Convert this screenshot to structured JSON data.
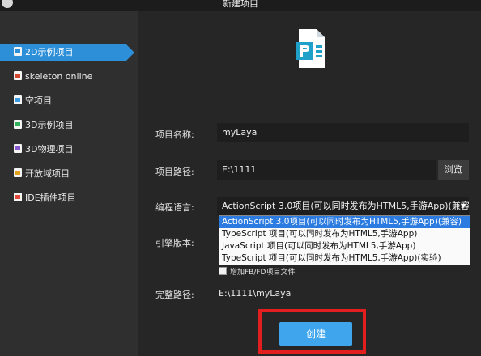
{
  "window": {
    "title": "新建项目"
  },
  "sidebar": {
    "items": [
      {
        "label": "2D示例项目",
        "active": true
      },
      {
        "label": "skeleton online"
      },
      {
        "label": "空项目"
      },
      {
        "label": "3D示例项目"
      },
      {
        "label": "3D物理项目"
      },
      {
        "label": "开放域项目"
      },
      {
        "label": "IDE插件项目"
      }
    ]
  },
  "form": {
    "name_label": "项目名称:",
    "name_value": "myLaya",
    "path_label": "项目路径:",
    "path_value": "E:\\1111",
    "browse_label": "浏览",
    "lang_label": "编程语言:",
    "lang_value": "ActionScript 3.0项目(可以同时发布为HTML5,手游App)(兼容)",
    "lang_options": [
      "ActionScript 3.0项目(可以同时发布为HTML5,手游App)(兼容)",
      "TypeScript 项目(可以同时发布为HTML5,手游App)",
      "JavaScript 项目(可以同时发布为HTML5,手游App)",
      "TypeScript 项目(可以同时发布为HTML5,手游App)(实验)"
    ],
    "engine_label": "引擎版本:",
    "fb_checkbox_label": "增加FB/FD项目文件",
    "fullpath_label": "完整路径:",
    "fullpath_value": "E:\\1111\\myLaya",
    "create_label": "创建"
  },
  "colors": {
    "accent": "#2d8fd8",
    "create_button": "#3fa6ee",
    "highlight": "#e31e1e"
  }
}
